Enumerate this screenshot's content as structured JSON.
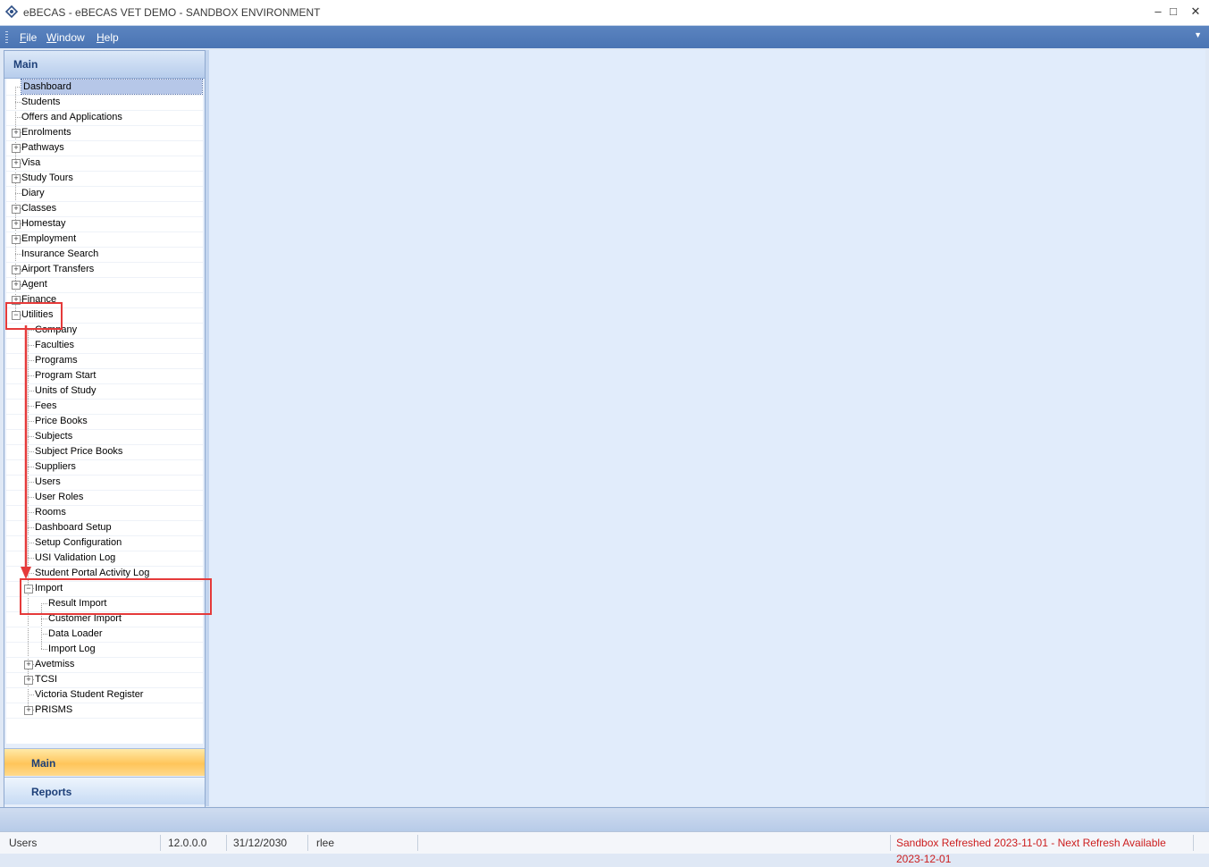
{
  "window": {
    "title": "eBECAS - eBECAS VET DEMO - SANDBOX ENVIRONMENT"
  },
  "menu": {
    "items": [
      "File",
      "Window",
      "Help"
    ]
  },
  "pane": {
    "header": "Main"
  },
  "tree": {
    "items": [
      "Dashboard",
      "Students",
      "Offers and Applications",
      "Enrolments",
      "Pathways",
      "Visa",
      "Study Tours",
      "Diary",
      "Classes",
      "Homestay",
      "Employment",
      "Insurance Search",
      "Airport Transfers",
      "Agent",
      "Finance",
      "Utilities",
      "Company",
      "Faculties",
      "Programs",
      "Program Start",
      "Units of Study",
      "Fees",
      "Price Books",
      "Subjects",
      "Subject Price Books",
      "Suppliers",
      "Users",
      "User Roles",
      "Rooms",
      "Dashboard Setup",
      "Setup Configuration",
      "USI Validation Log",
      "Student Portal Activity Log",
      "Import",
      "Result Import",
      "Customer Import",
      "Data Loader",
      "Import Log",
      "Avetmiss",
      "TCSI",
      "Victoria Student Register",
      "PRISMS"
    ]
  },
  "nav": {
    "main": "Main",
    "reports": "Reports"
  },
  "status": {
    "section": "Users",
    "version": "12.0.0.0",
    "date": "31/12/2030",
    "user": "rlee",
    "sandbox_notice": "Sandbox Refreshed 2023-11-01 - Next Refresh Available 2023-12-01",
    "notice_color": "#cc1e1e"
  },
  "annotation_color": "#e53a3a"
}
